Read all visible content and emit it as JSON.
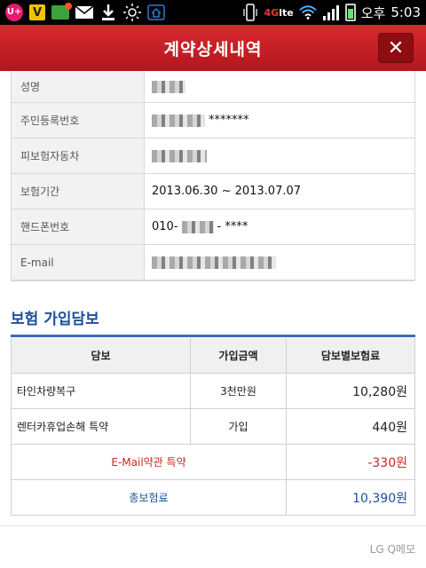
{
  "status_bar": {
    "lte": "4G",
    "lte_mark": "lte",
    "ampm": "오후",
    "time": "5:03",
    "uplus_label": "U+",
    "check_label": "V"
  },
  "header": {
    "title": "계약상세내역",
    "close_label": "✕"
  },
  "info": {
    "rows": [
      {
        "label": "성명",
        "value": ""
      },
      {
        "label": "주민등록번호",
        "value": "*******"
      },
      {
        "label": "피보험자동차",
        "value": ""
      },
      {
        "label": "보험기간",
        "value": "2013.06.30 ~ 2013.07.07"
      },
      {
        "label": "핸드폰번호",
        "value_prefix": "010-",
        "value_suffix": "- ****"
      },
      {
        "label": "E-mail",
        "value": ""
      }
    ]
  },
  "coverage": {
    "section_title": "보험 가입담보",
    "headers": [
      "담보",
      "가입금액",
      "담보별보험료"
    ],
    "rows": [
      {
        "name": "타인차량복구",
        "amount": "3천만원",
        "premium": "10,280원"
      },
      {
        "name": "렌터카휴업손해 특약",
        "amount": "가입",
        "premium": "440원"
      }
    ],
    "discount": {
      "name": "E-Mail약관 특약",
      "premium": "-330원"
    },
    "total": {
      "name": "총보험료",
      "premium": "10,390원"
    }
  },
  "footer": {
    "memo": "LG Q메모"
  },
  "colors": {
    "header_red": "#c62026",
    "section_blue": "#1f4f99",
    "discount_red": "#c62828"
  }
}
